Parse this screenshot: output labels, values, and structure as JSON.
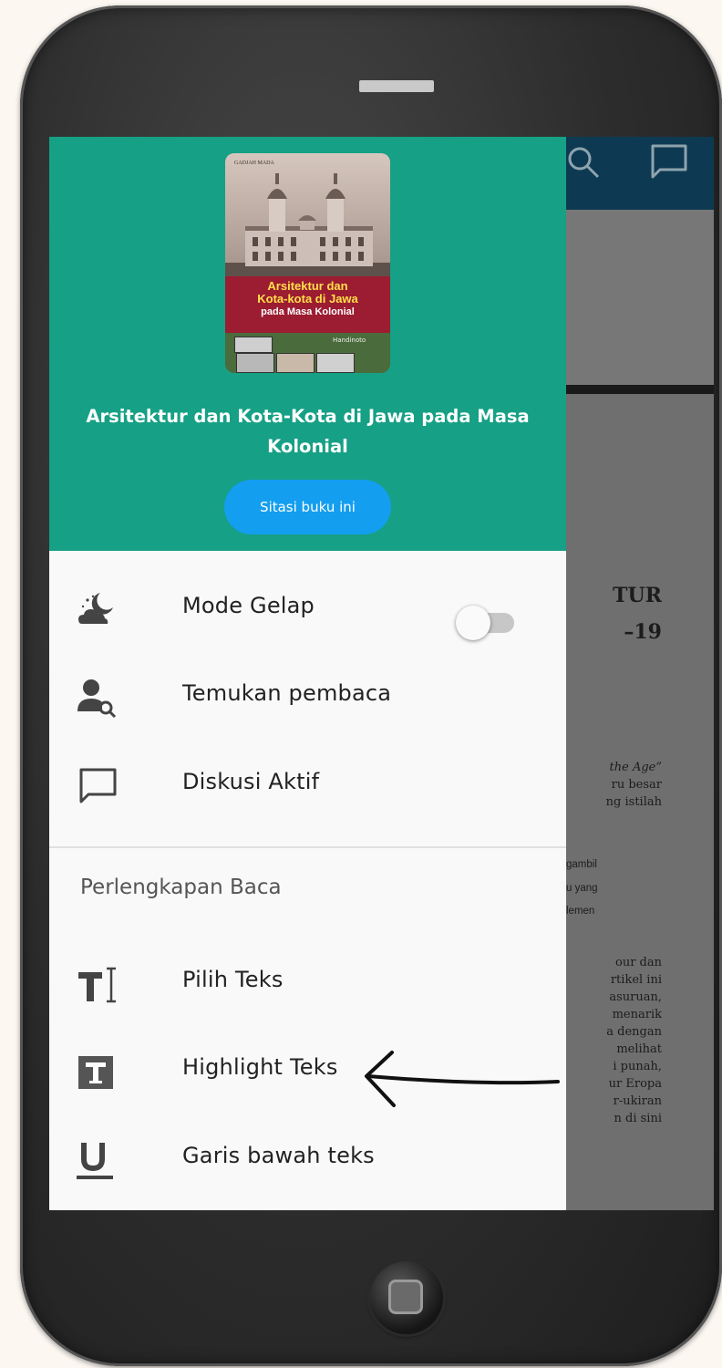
{
  "book": {
    "cover": {
      "publisher": "GADJAH MADA",
      "title_line1": "Arsitektur dan",
      "title_line2": "Kota-kota di Jawa",
      "title_line3": "pada Masa Kolonial",
      "author": "Handinoto"
    },
    "title": "Arsitektur dan Kota-Kota di Jawa pada Masa Kolonial",
    "cite_button": "Sitasi buku ini"
  },
  "menu": {
    "dark_mode": {
      "label": "Mode Gelap",
      "enabled": false,
      "icon": "night-cloud-icon"
    },
    "find_readers": {
      "label": "Temukan pembaca",
      "icon": "user-search-icon"
    },
    "active_discussion": {
      "label": "Diskusi Aktif",
      "icon": "chat-bubble-icon"
    }
  },
  "reading_tools": {
    "section_label": "Perlengkapan Baca",
    "select_text": {
      "label": "Pilih Teks",
      "icon": "text-cursor-icon"
    },
    "highlight_text": {
      "label": "Highlight Teks",
      "icon": "highlight-t-icon"
    },
    "underline_text": {
      "label": "Garis bawah teks",
      "icon": "underline-icon"
    }
  },
  "background_page": {
    "heading_lines": [
      "TUR",
      "–19"
    ],
    "paragraph1": [
      "the Age”",
      "ru besar",
      "ng istilah"
    ],
    "paragraph2": [
      "gambil",
      "u yang",
      "lemen"
    ],
    "paragraph3": [
      "our dan",
      "rtikel ini",
      "asuruan,",
      "menarik",
      "a dengan",
      "melihat",
      "i punah,",
      "ur Eropa",
      "r-ukiran",
      "n di sini"
    ]
  },
  "colors": {
    "drawer_header": "#16a085",
    "cite_button": "#139ef0",
    "app_bar": "#0d3a52"
  }
}
